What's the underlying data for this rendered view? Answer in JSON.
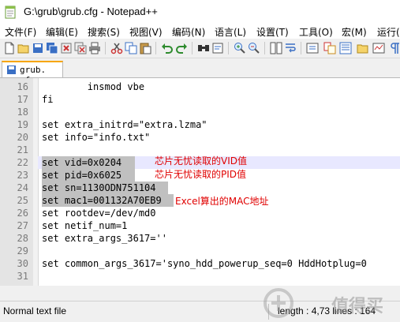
{
  "window": {
    "title": "G:\\grub\\grub.cfg - Notepad++"
  },
  "menu": [
    {
      "label": "文件(F)"
    },
    {
      "label": "编辑(E)"
    },
    {
      "label": "搜索(S)"
    },
    {
      "label": "视图(V)"
    },
    {
      "label": "编码(N)"
    },
    {
      "label": "语言(L)"
    },
    {
      "label": "设置(T)"
    },
    {
      "label": "工具(O)"
    },
    {
      "label": "宏(M)"
    },
    {
      "label": "运行("
    }
  ],
  "tab": {
    "label": "grub. cfg"
  },
  "lines": [
    {
      "num": "16",
      "text": "        insmod vbe"
    },
    {
      "num": "17",
      "text": "fi"
    },
    {
      "num": "18",
      "text": ""
    },
    {
      "num": "19",
      "text": "set extra_initrd=\"extra.lzma\""
    },
    {
      "num": "20",
      "text": "set info=\"info.txt\""
    },
    {
      "num": "21",
      "text": ""
    },
    {
      "num": "22",
      "text": "set vid=0x0204"
    },
    {
      "num": "23",
      "text": "set pid=0x6025"
    },
    {
      "num": "24",
      "text": "set sn=1130ODN751104"
    },
    {
      "num": "25",
      "text": "set mac1=001132A70EB9"
    },
    {
      "num": "26",
      "text": "set rootdev=/dev/md0"
    },
    {
      "num": "27",
      "text": "set netif_num=1"
    },
    {
      "num": "28",
      "text": "set extra_args_3617=''"
    },
    {
      "num": "29",
      "text": ""
    },
    {
      "num": "30",
      "text": "set common_args_3617='syno_hdd_powerup_seq=0 HddHotplug=0"
    },
    {
      "num": "31",
      "text": ""
    }
  ],
  "annotations": {
    "vid": "芯片无忧读取的VID值",
    "pid": "芯片无忧读取的PID值",
    "mac": "Excel算出的MAC地址"
  },
  "status": {
    "file_type": "Normal text file",
    "right": "length : 4,73  lines : 164"
  },
  "watermark": {
    "text": "值得买"
  },
  "colors": {
    "selection": "#c0c0c0",
    "caret_line": "#e8e8ff",
    "annotation": "#e00000",
    "active_tab_accent": "#f7a600"
  }
}
